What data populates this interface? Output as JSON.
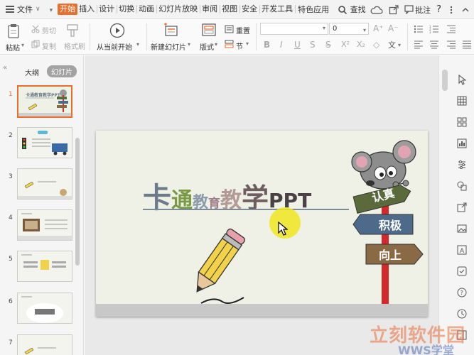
{
  "menu": {
    "file": "文件",
    "tabs": [
      "开始",
      "插入",
      "设计",
      "切换",
      "动画",
      "幻灯片放映",
      "审阅",
      "视图",
      "安全",
      "开发工具",
      "特色应用"
    ],
    "search": "查找",
    "comment": "批注",
    "help": "?"
  },
  "ribbon": {
    "paste": "粘贴",
    "cut": "剪切",
    "copy": "复制",
    "format_painter": "格式刷",
    "from_current": "从当前开始",
    "new_slide": "新建幻灯片",
    "layout": "版式",
    "reset": "重置",
    "section": "节",
    "font_size": "0"
  },
  "left_panel": {
    "tab_outline": "大纲",
    "tab_slides": "幻灯片",
    "slide_numbers": [
      "1",
      "2",
      "3",
      "4",
      "5",
      "6",
      "7"
    ],
    "selected": 1
  },
  "slide": {
    "title_chars": [
      "卡",
      "通",
      "教",
      "育",
      "教",
      "学",
      "PPT"
    ],
    "signs": [
      "认真",
      "积极",
      "向上"
    ]
  },
  "watermark": {
    "text": "立刻软件园",
    "sub": "WWS学堂"
  },
  "colors": {
    "accent": "#e86f2c",
    "sign_green": "#5a6a3a",
    "sign_blue": "#4e6a8a",
    "sign_brown": "#8a6a45",
    "pole_red": "#d4282a"
  }
}
